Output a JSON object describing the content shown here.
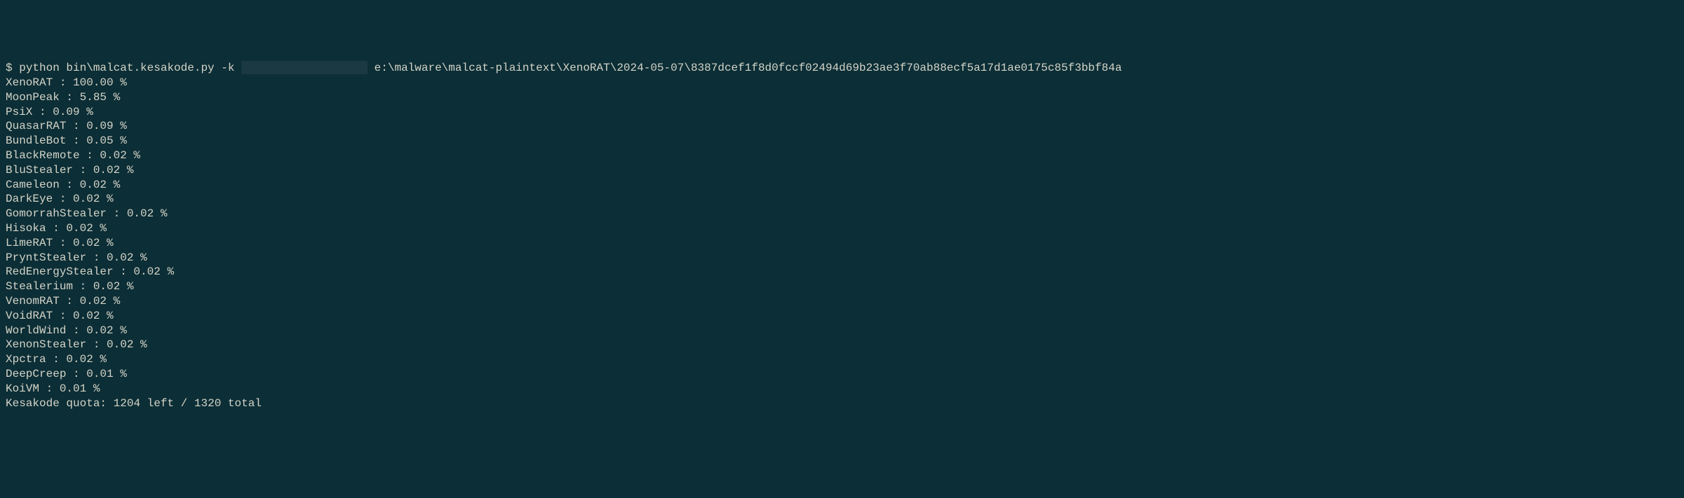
{
  "prompt": {
    "symbol": "$",
    "command_before": " python bin\\malcat.kesakode.py -k ",
    "command_after": " e:\\malware\\malcat-plaintext\\XenoRAT\\2024-05-07\\8387dcef1f8d0fccf02494d69b23ae3f70ab88ecf5a17d1ae0175c85f3bbf84a"
  },
  "results": [
    {
      "name": "XenoRAT",
      "value": "100.00",
      "unit": "%"
    },
    {
      "name": "MoonPeak",
      "value": "5.85",
      "unit": "%"
    },
    {
      "name": "PsiX",
      "value": "0.09",
      "unit": "%"
    },
    {
      "name": "QuasarRAT",
      "value": "0.09",
      "unit": "%"
    },
    {
      "name": "BundleBot",
      "value": "0.05",
      "unit": "%"
    },
    {
      "name": "BlackRemote",
      "value": "0.02",
      "unit": "%"
    },
    {
      "name": "BluStealer",
      "value": "0.02",
      "unit": "%"
    },
    {
      "name": "Cameleon",
      "value": "0.02",
      "unit": "%"
    },
    {
      "name": "DarkEye",
      "value": "0.02",
      "unit": "%"
    },
    {
      "name": "GomorrahStealer",
      "value": "0.02",
      "unit": "%"
    },
    {
      "name": "Hisoka",
      "value": "0.02",
      "unit": "%"
    },
    {
      "name": "LimeRAT",
      "value": "0.02",
      "unit": "%"
    },
    {
      "name": "PryntStealer",
      "value": "0.02",
      "unit": "%"
    },
    {
      "name": "RedEnergyStealer",
      "value": "0.02",
      "unit": "%"
    },
    {
      "name": "Stealerium",
      "value": "0.02",
      "unit": "%"
    },
    {
      "name": "VenomRAT",
      "value": "0.02",
      "unit": "%"
    },
    {
      "name": "VoidRAT",
      "value": "0.02",
      "unit": "%"
    },
    {
      "name": "WorldWind",
      "value": "0.02",
      "unit": "%"
    },
    {
      "name": "XenonStealer",
      "value": "0.02",
      "unit": "%"
    },
    {
      "name": "Xpctra",
      "value": "0.02",
      "unit": "%"
    },
    {
      "name": "DeepCreep",
      "value": "0.01",
      "unit": "%"
    },
    {
      "name": "KoiVM",
      "value": "0.01",
      "unit": "%"
    }
  ],
  "quota": {
    "label": "Kesakode quota:",
    "left": "1204",
    "left_label": "left",
    "separator": "/",
    "total": "1320",
    "total_label": "total"
  }
}
